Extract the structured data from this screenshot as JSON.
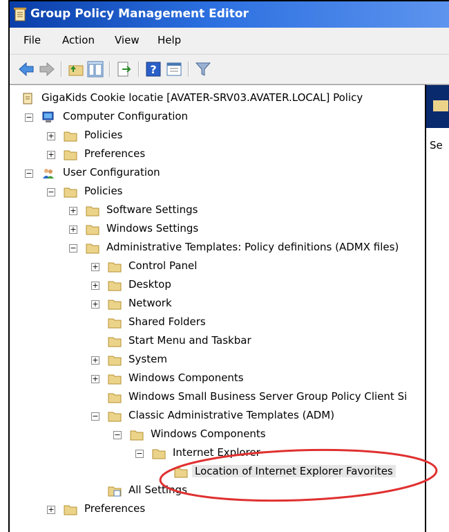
{
  "window": {
    "title": "Group Policy Management Editor"
  },
  "menu": [
    "File",
    "Action",
    "View",
    "Help"
  ],
  "toolbar": {
    "buttons": [
      "back-arrow-icon",
      "forward-arrow-icon",
      "up-folder-icon",
      "show-hide-tree-icon",
      "export-list-icon",
      "help-icon",
      "properties-icon",
      "filter-icon"
    ]
  },
  "tree": {
    "root": "GigaKids Cookie locatie [AVATER-SRV03.AVATER.LOCAL] Policy",
    "computer_configuration": "Computer Configuration",
    "cc_policies": "Policies",
    "cc_preferences": "Preferences",
    "user_configuration": "User Configuration",
    "uc_policies": "Policies",
    "software_settings": "Software Settings",
    "windows_settings": "Windows Settings",
    "admin_templates": "Administrative Templates: Policy definitions (ADMX files)",
    "control_panel": "Control Panel",
    "desktop": "Desktop",
    "network": "Network",
    "shared_folders": "Shared Folders",
    "start_menu": "Start Menu and Taskbar",
    "system": "System",
    "windows_components": "Windows Components",
    "sbs_gp_client": "Windows Small Business Server Group Policy Client Si",
    "classic_admin": "Classic Administrative Templates (ADM)",
    "classic_windows_components": "Windows Components",
    "internet_explorer": "Internet Explorer",
    "ie_favorites": "Location of Internet Explorer Favorites",
    "all_settings": "All Settings",
    "uc_preferences": "Preferences"
  },
  "right_pane": {
    "partial_text": "Se"
  },
  "colors": {
    "title_bar": "#0a3ea8",
    "annotation": "#e03030",
    "folder": "#ecd38a"
  }
}
